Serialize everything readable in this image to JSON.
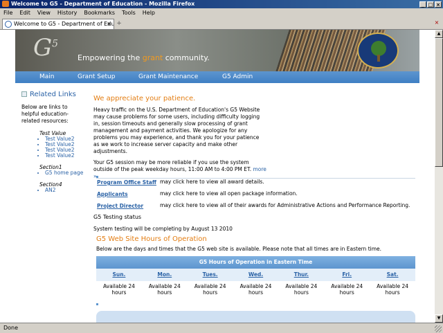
{
  "window": {
    "title": "Welcome to G5 - Department of Education - Mozilla Firefox"
  },
  "menu": [
    "File",
    "Edit",
    "View",
    "History",
    "Bookmarks",
    "Tools",
    "Help"
  ],
  "tab": {
    "title": "Welcome to G5 - Department of Edu..."
  },
  "status": "Done",
  "banner": {
    "logo": "G",
    "logo_sup": "5",
    "tagline_pre": "Empowering the ",
    "tagline_accent": "grant",
    "tagline_post": " community."
  },
  "nav": [
    "Main",
    "Grant Setup",
    "Grant Maintenance",
    "G5 Admin"
  ],
  "related": {
    "title": "Related Links",
    "intro": "Below are links to helpful education-related resources:",
    "sections": [
      {
        "name": "Test Value",
        "items": [
          "Test Value2",
          "Test Value2",
          "Test Value2",
          "Test Value2"
        ]
      },
      {
        "name": "Section1",
        "items": [
          "G5 home page"
        ]
      },
      {
        "name": "Section4",
        "items": [
          "AN2"
        ]
      }
    ]
  },
  "notice": {
    "heading": "We appreciate your patience.",
    "p1": "Heavy traffic on the U.S. Department of Education's G5 Website may cause problems for some users, including difficulty logging in, session timeouts and generally slow processing of grant management and payment activities. We apologize for any problems you may experience, and thank you for your patience as we work to increase server capacity and make other adjustments.",
    "p2": "Your G5 session may be more reliable if you use the system outside of the peak weekday hours, 11:00 AM to 4:00 PM ET.",
    "more": "more »"
  },
  "roles": [
    {
      "label": "Program Office Staff",
      "desc": "may click here to view all award details."
    },
    {
      "label": "Applicants",
      "desc": "may click here to view all open package information."
    },
    {
      "label": "Project Director",
      "desc": "may click here to view all of their awards for Administrative Actions and Performance Reporting."
    }
  ],
  "testing": {
    "title": "G5 Testing status",
    "text": "System testing will be completing by August 13 2010"
  },
  "hours": {
    "heading": "G5 Web Site Hours of Operation",
    "intro": "Below are the days and times that the G5 web site is available. Please note that all times are in Eastern time.",
    "table_title": "G5 Hours of Operation in Eastern Time",
    "days": [
      "Sun.",
      "Mon.",
      "Tues.",
      "Wed.",
      "Thur.",
      "Fri.",
      "Sat."
    ],
    "values": [
      "Available 24 hours",
      "Available 24 hours",
      "Available 24 hours",
      "Available 24 hours",
      "Available 24 hours",
      "Available 24 hours",
      "Available 24 hours"
    ]
  }
}
